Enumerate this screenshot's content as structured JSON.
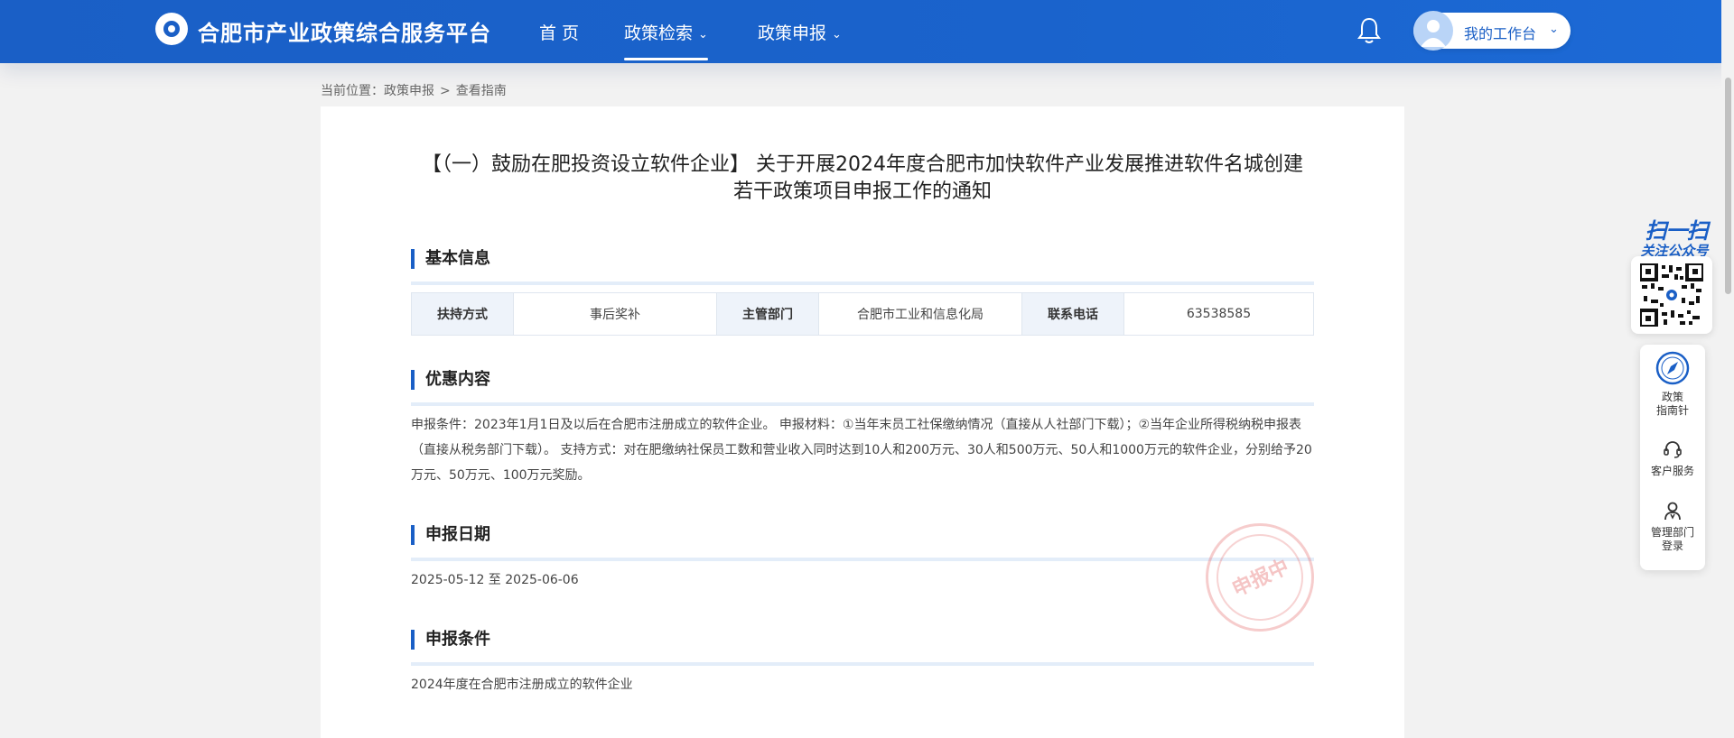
{
  "header": {
    "brand": "合肥市产业政策综合服务平台",
    "nav": [
      {
        "label": "首 页"
      },
      {
        "label": "政策检索",
        "chevron": "chevron-down-icon",
        "active": true
      },
      {
        "label": "政策申报",
        "chevron": "chevron-down-icon"
      }
    ],
    "workbench_label": "我的工作台",
    "accent_color": "#1a5fc6"
  },
  "breadcrumb": {
    "prefix": "当前位置：",
    "items": [
      "政策申报",
      ">",
      "查看指南"
    ]
  },
  "notice": {
    "title_line1": "【（一）鼓励在肥投资设立软件企业】 关于开展2024年度合肥市加快软件产业发展推进软件名城创建",
    "title_line2": "若干政策项目申报工作的通知",
    "basic_info": {
      "heading": "基本信息",
      "cells": [
        {
          "key": "扶持方式",
          "value": "事后奖补"
        },
        {
          "key": "主管部门",
          "value": "合肥市工业和信息化局"
        },
        {
          "key": "联系电话",
          "value": "63538585"
        }
      ]
    },
    "benefits": {
      "heading": "优惠内容",
      "line1": "申报条件：2023年1月1日及以后在合肥市注册成立的软件企业。 申报材料：①当年末员工社保缴纳情况（直接从人社部门下载）；②当年企业所得税纳税申报表",
      "line2": "（直接从税务部门下载）。 支持方式：对在肥缴纳社保员工数和营业收入同时达到10人和200万元、30人和500万元、50人和1000万元的软件企业，分别给予20",
      "line3": "万元、50万元、100万元奖励。"
    },
    "apply_date": {
      "heading": "申报日期",
      "value": "2025-05-12 至 2025-06-06"
    },
    "apply_conditions": {
      "heading": "申报条件",
      "value": "2024年度在合肥市注册成立的软件企业"
    },
    "stamp_text": "申报中"
  },
  "sidebar": {
    "qr_title": "扫一扫",
    "qr_subtitle": "关注公众号",
    "items": [
      {
        "label_line1": "政策",
        "label_line2": "指南针",
        "icon": "compass-icon"
      },
      {
        "label_line1": "客户服务",
        "label_line2": "",
        "icon": "headset-icon"
      },
      {
        "label_line1": "管理部门",
        "label_line2": "登录",
        "icon": "user-icon"
      }
    ]
  }
}
